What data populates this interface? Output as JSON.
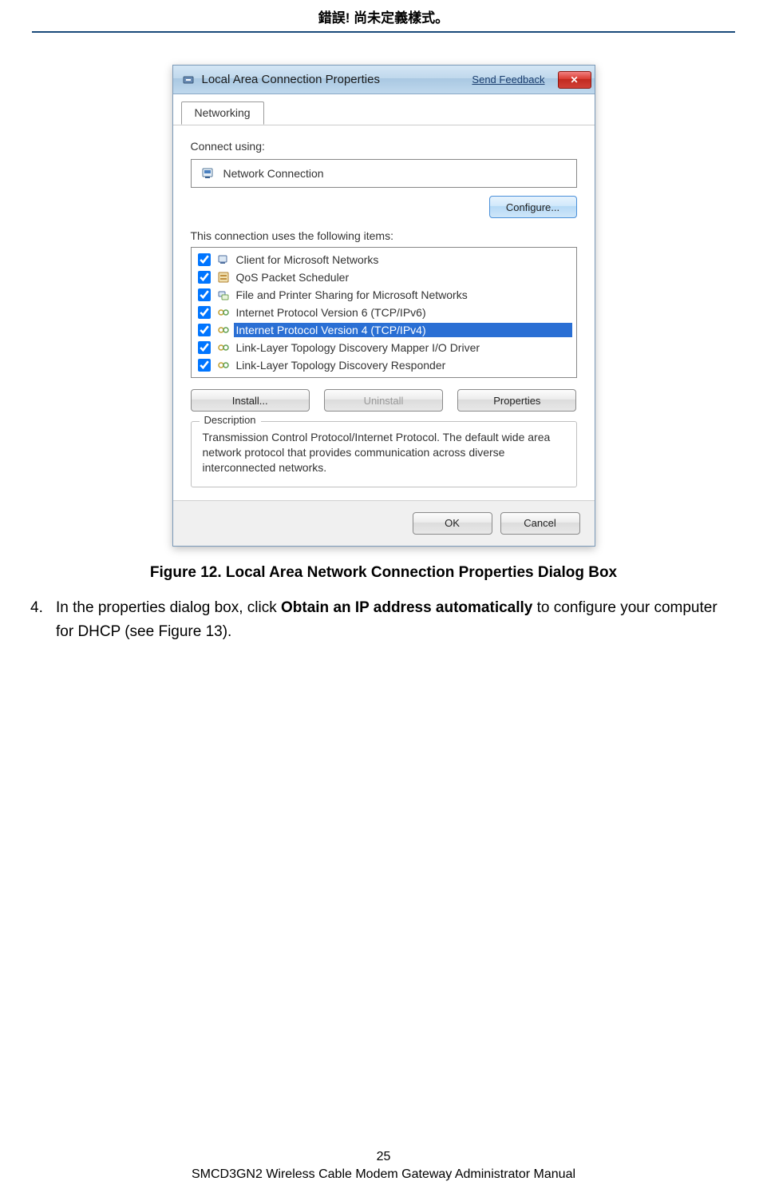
{
  "header": {
    "title": "錯誤! 尚未定義樣式。"
  },
  "dialog": {
    "title": "Local Area Connection Properties",
    "sendFeedback": "Send Feedback",
    "tab": "Networking",
    "connectUsing": "Connect using:",
    "adapter": "Network Connection",
    "configureBtn": "Configure...",
    "itemsLabel": "This connection uses the following items:",
    "items": [
      {
        "label": "Client for Microsoft Networks",
        "checked": true,
        "icon": "client"
      },
      {
        "label": "QoS Packet Scheduler",
        "checked": true,
        "icon": "qos"
      },
      {
        "label": "File and Printer Sharing for Microsoft Networks",
        "checked": true,
        "icon": "share"
      },
      {
        "label": "Internet Protocol Version 6 (TCP/IPv6)",
        "checked": true,
        "icon": "proto"
      },
      {
        "label": "Internet Protocol Version 4 (TCP/IPv4)",
        "checked": true,
        "icon": "proto",
        "selected": true
      },
      {
        "label": "Link-Layer Topology Discovery Mapper I/O Driver",
        "checked": true,
        "icon": "proto"
      },
      {
        "label": "Link-Layer Topology Discovery Responder",
        "checked": true,
        "icon": "proto"
      }
    ],
    "installBtn": "Install...",
    "uninstallBtn": "Uninstall",
    "propertiesBtn": "Properties",
    "descLegend": "Description",
    "descText": "Transmission Control Protocol/Internet Protocol. The default wide area network protocol that provides communication across diverse interconnected networks.",
    "okBtn": "OK",
    "cancelBtn": "Cancel"
  },
  "caption": "Figure 12. Local Area Network Connection Properties Dialog Box",
  "step": {
    "num": "4.",
    "pre": "In the properties dialog box, click ",
    "bold": "Obtain an IP address automatically",
    "post": " to configure your computer for DHCP (see Figure 13)."
  },
  "footer": {
    "pageno": "25",
    "manual": "SMCD3GN2 Wireless Cable Modem Gateway Administrator Manual"
  }
}
